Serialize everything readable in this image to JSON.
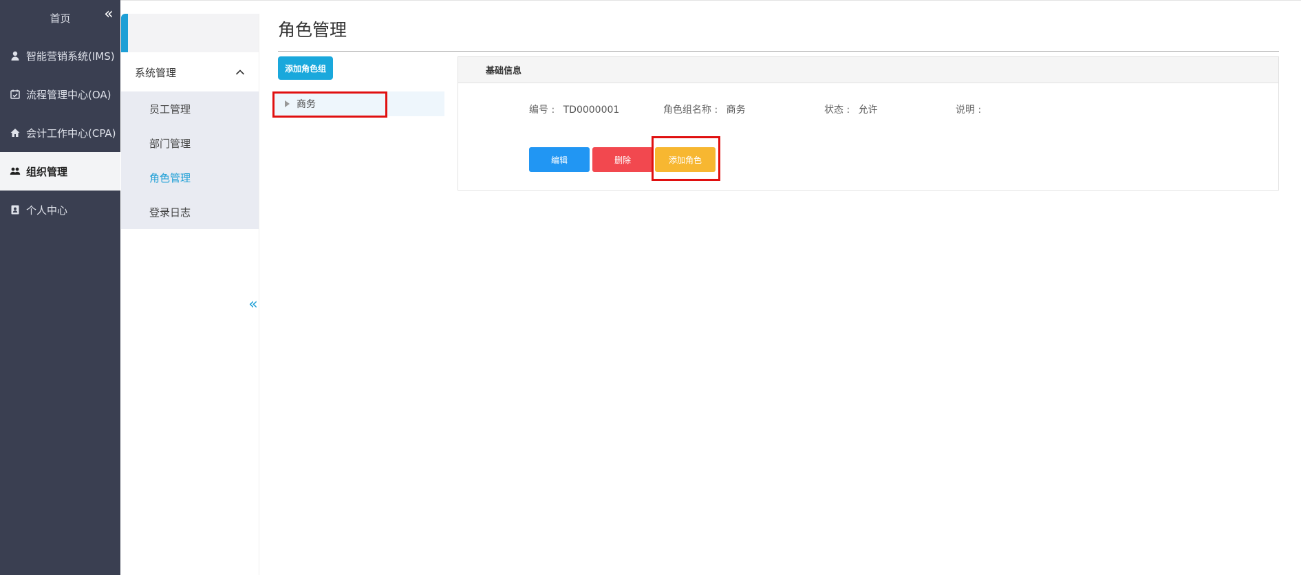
{
  "sidebar": {
    "home_label": "首页",
    "collapse_glyph": "«",
    "items": [
      {
        "label": "智能营销系统(IMS)",
        "icon": "user-icon"
      },
      {
        "label": "流程管理中心(OA)",
        "icon": "calendar-check-icon"
      },
      {
        "label": "会计工作中心(CPA)",
        "icon": "home-icon"
      },
      {
        "label": "组织管理",
        "icon": "users-icon",
        "active": true
      },
      {
        "label": "个人中心",
        "icon": "contact-book-icon"
      }
    ]
  },
  "submenu": {
    "header_label": "系统管理",
    "collapse_glyph": "«",
    "items": [
      {
        "label": "员工管理"
      },
      {
        "label": "部门管理"
      },
      {
        "label": "角色管理",
        "active": true
      },
      {
        "label": "登录日志"
      }
    ]
  },
  "main": {
    "title": "角色管理",
    "add_group_label": "添加角色组",
    "tree": [
      {
        "label": "商务"
      }
    ],
    "panel": {
      "header": "基础信息",
      "fields": {
        "code_label": "编号 :",
        "code_value": "TD0000001",
        "name_label": "角色组名称 :",
        "name_value": "商务",
        "status_label": "状态 :",
        "status_value": "允许",
        "desc_label": "说明 :",
        "desc_value": ""
      },
      "buttons": {
        "edit": "编辑",
        "delete": "删除",
        "add_role": "添加角色"
      }
    }
  },
  "colors": {
    "sidebar_bg": "#3a3f51",
    "accent_blue": "#1aa8dc",
    "edit_blue": "#2196f3",
    "delete_red": "#f2484f",
    "add_role_yellow": "#f7b731",
    "highlight_red": "#e01010"
  }
}
